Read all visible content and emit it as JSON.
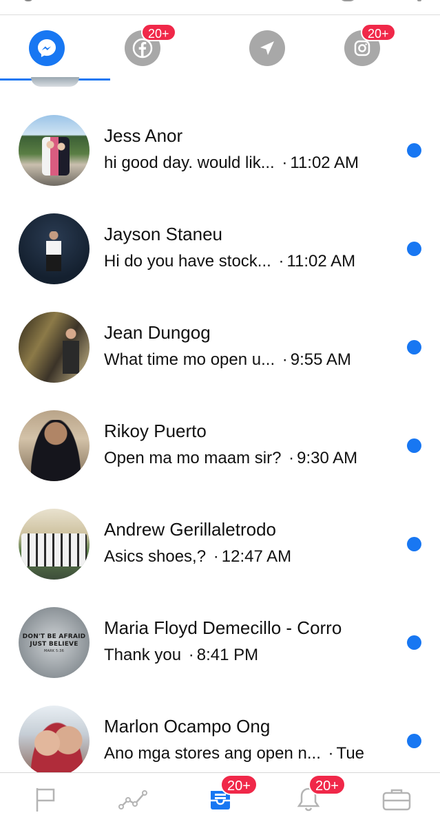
{
  "top_tabs": [
    {
      "id": "messenger",
      "icon": "messenger-icon",
      "active": true,
      "badge": ""
    },
    {
      "id": "facebook",
      "icon": "facebook-icon",
      "active": false,
      "badge": "20+"
    },
    {
      "id": "direct",
      "icon": "send-icon",
      "active": false,
      "badge": ""
    },
    {
      "id": "instagram",
      "icon": "instagram-icon",
      "active": false,
      "badge": "20+"
    }
  ],
  "conversations": [
    {
      "name": "Jess Anor",
      "snippet": "hi good day. would lik...",
      "separator": "·",
      "time": "11:02 AM",
      "unread": true
    },
    {
      "name": "Jayson Staneu",
      "snippet": "Hi do you have stock...",
      "separator": "·",
      "time": "11:02 AM",
      "unread": true
    },
    {
      "name": "Jean Dungog",
      "snippet": "What time mo open u...",
      "separator": "·",
      "time": "9:55 AM",
      "unread": true
    },
    {
      "name": "Rikoy Puerto",
      "snippet": "Open ma mo maam sir?",
      "separator": "·",
      "time": "9:30 AM",
      "unread": true
    },
    {
      "name": "Andrew Gerillaletrodo",
      "snippet": "Asics shoes,?",
      "separator": "·",
      "time": "12:47 AM",
      "unread": true
    },
    {
      "name": "Maria Floyd Demecillo - Corro",
      "snippet": "Thank you",
      "separator": "·",
      "time": "8:41 PM",
      "unread": true
    },
    {
      "name": "Marlon Ocampo Ong",
      "snippet": "Ano mga stores ang open n...",
      "separator": "·",
      "time": "Tue",
      "unread": true
    }
  ],
  "avatar_texts": {
    "maria": {
      "line1": "DON'T BE AFRAID",
      "line2": "JUST BELIEVE",
      "line3": "MARK 5:36"
    }
  },
  "bottom_nav": [
    {
      "id": "pages",
      "icon": "flag-icon",
      "badge": ""
    },
    {
      "id": "insights",
      "icon": "insights-icon",
      "badge": ""
    },
    {
      "id": "inbox",
      "icon": "inbox-icon",
      "badge": "20+",
      "active": true
    },
    {
      "id": "notifications",
      "icon": "bell-icon",
      "badge": "20+"
    },
    {
      "id": "tools",
      "icon": "briefcase-icon",
      "badge": ""
    }
  ],
  "colors": {
    "accent": "#1877f2",
    "badge": "#f02849",
    "inactive_icon": "#a8a8a8"
  }
}
